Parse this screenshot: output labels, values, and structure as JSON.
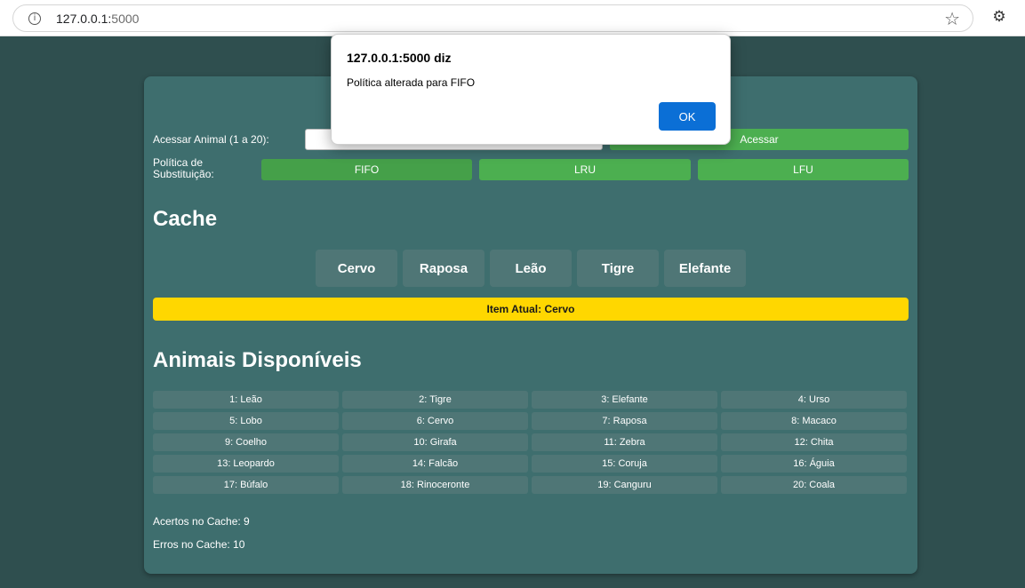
{
  "browser": {
    "url_host": "127.0.0.1:",
    "url_port": "5000"
  },
  "form": {
    "access_label": "Acessar Animal (1 a 20):",
    "access_input_value": "",
    "access_button": "Acessar",
    "policy_label": "Política de Substituição:",
    "policies": [
      "FIFO",
      "LRU",
      "LFU"
    ]
  },
  "cache": {
    "heading": "Cache",
    "items": [
      "Cervo",
      "Raposa",
      "Leão",
      "Tigre",
      "Elefante"
    ],
    "current_item": "Item Atual: Cervo"
  },
  "animals": {
    "heading": "Animais Disponíveis",
    "list": [
      "1: Leão",
      "2: Tigre",
      "3: Elefante",
      "4: Urso",
      "5: Lobo",
      "6: Cervo",
      "7: Raposa",
      "8: Macaco",
      "9: Coelho",
      "10: Girafa",
      "11: Zebra",
      "12: Chita",
      "13: Leopardo",
      "14: Falcão",
      "15: Coruja",
      "16: Águia",
      "17: Búfalo",
      "18: Rinoceronte",
      "19: Canguru",
      "20: Coala"
    ]
  },
  "stats": {
    "hits": "Acertos no Cache: 9",
    "misses": "Erros no Cache: 10"
  },
  "dialog": {
    "title": "127.0.0.1:5000 diz",
    "message": "Política alterada para FIFO",
    "ok": "OK"
  }
}
